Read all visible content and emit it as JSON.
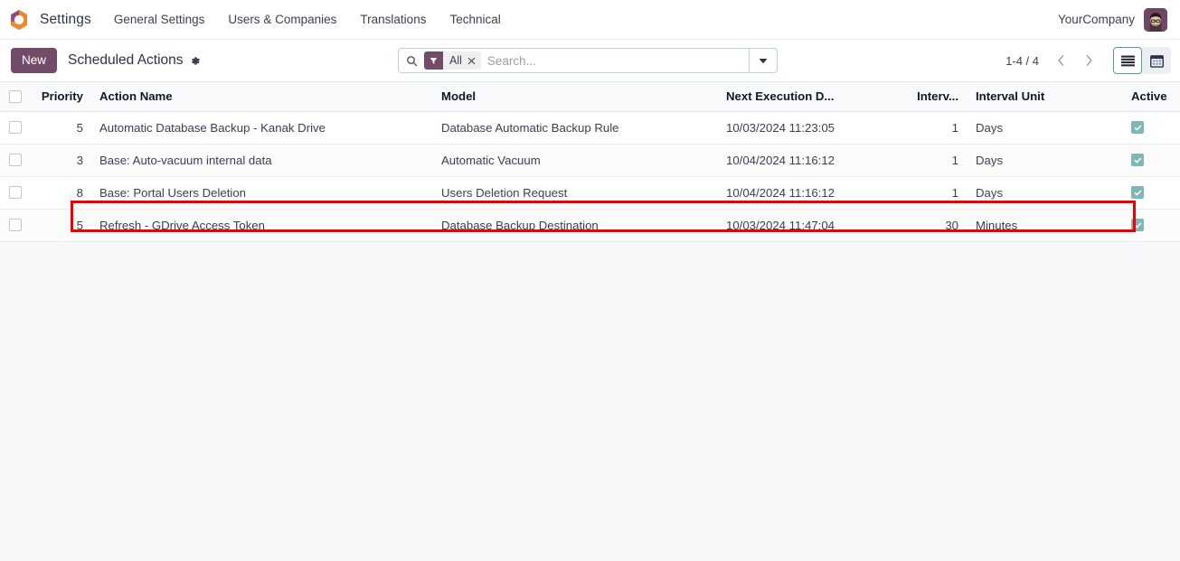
{
  "navbar": {
    "logo_icon": "odoo-logo-icon",
    "app_name": "Settings",
    "menu_items": [
      {
        "label": "General Settings"
      },
      {
        "label": "Users & Companies"
      },
      {
        "label": "Translations"
      },
      {
        "label": "Technical"
      }
    ],
    "company": "YourCompany",
    "avatar_icon": "user-avatar"
  },
  "control_panel": {
    "new_label": "New",
    "breadcrumb": "Scheduled Actions",
    "gear_icon": "gear-icon",
    "search": {
      "search_icon": "search-icon",
      "facet_icon": "filter-icon",
      "facet_label": "All",
      "facet_remove_icon": "close-icon",
      "placeholder": "Search...",
      "value": "",
      "toggle_icon": "chevron-down-icon"
    },
    "pager": {
      "range": "1-4 / 4",
      "prev_icon": "chevron-left-icon",
      "next_icon": "chevron-right-icon"
    },
    "views": [
      {
        "name": "list",
        "icon": "list-view-icon",
        "active": true
      },
      {
        "name": "calendar",
        "icon": "calendar-view-icon",
        "active": false
      }
    ]
  },
  "list": {
    "columns": [
      {
        "key": "priority",
        "label": "Priority"
      },
      {
        "key": "name",
        "label": "Action Name"
      },
      {
        "key": "model",
        "label": "Model"
      },
      {
        "key": "next",
        "label": "Next Execution D..."
      },
      {
        "key": "interval",
        "label": "Interv..."
      },
      {
        "key": "unit",
        "label": "Interval Unit"
      },
      {
        "key": "active",
        "label": "Active"
      }
    ],
    "optional_columns_icon": "adjust-columns-icon",
    "rows": [
      {
        "priority": "5",
        "name": "Automatic Database Backup - Kanak Drive",
        "model": "Database Automatic Backup Rule",
        "next": "10/03/2024 11:23:05",
        "interval": "1",
        "unit": "Days",
        "active": true,
        "highlighted": true
      },
      {
        "priority": "3",
        "name": "Base: Auto-vacuum internal data",
        "model": "Automatic Vacuum",
        "next": "10/04/2024 11:16:12",
        "interval": "1",
        "unit": "Days",
        "active": true,
        "highlighted": false
      },
      {
        "priority": "8",
        "name": "Base: Portal Users Deletion",
        "model": "Users Deletion Request",
        "next": "10/04/2024 11:16:12",
        "interval": "1",
        "unit": "Days",
        "active": true,
        "highlighted": false
      },
      {
        "priority": "5",
        "name": "Refresh - GDrive Access Token",
        "model": "Database Backup Destination",
        "next": "10/03/2024 11:47:04",
        "interval": "30",
        "unit": "Minutes",
        "active": true,
        "highlighted": false
      }
    ]
  },
  "colors": {
    "brand_purple": "#714b67",
    "accent_teal": "#5b9a9a",
    "check_teal": "#7fb7b7",
    "highlight_red": "#ec0000",
    "page_bg": "#f6f7f9",
    "logo_orange": "#f0862e",
    "logo_purple": "#8f4d7f"
  }
}
